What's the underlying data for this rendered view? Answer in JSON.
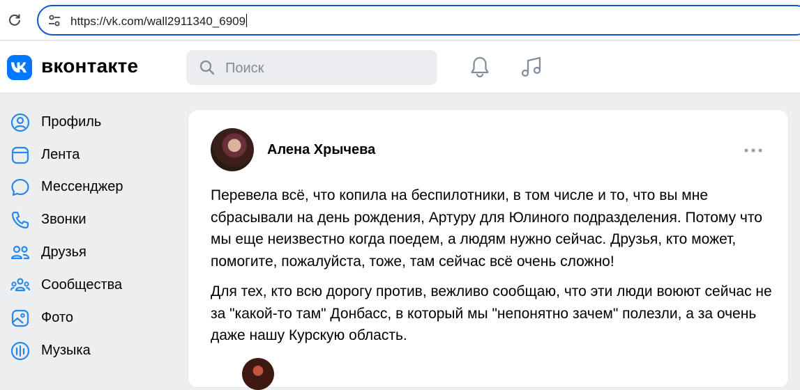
{
  "browser": {
    "url": "https://vk.com/wall2911340_6909"
  },
  "header": {
    "logo_text": "вконтакте",
    "search_placeholder": "Поиск"
  },
  "sidebar": {
    "items": [
      {
        "label": "Профиль",
        "icon": "profile-icon"
      },
      {
        "label": "Лента",
        "icon": "feed-icon"
      },
      {
        "label": "Мессенджер",
        "icon": "messenger-icon"
      },
      {
        "label": "Звонки",
        "icon": "phone-icon"
      },
      {
        "label": "Друзья",
        "icon": "friends-icon"
      },
      {
        "label": "Сообщества",
        "icon": "communities-icon"
      },
      {
        "label": "Фото",
        "icon": "photo-icon"
      },
      {
        "label": "Музыка",
        "icon": "music-icon"
      }
    ]
  },
  "post": {
    "author": "Алена Хрычева",
    "paragraphs": [
      "Перевела всё, что копила на беспилотники, в том числе и то, что вы мне сбрасывали на день рождения, Артуру для Юлиного подразделения. Потому что мы еще неизвестно когда поедем, а людям нужно сейчас. Друзья, кто может, помогите, пожалуйста, тоже, там сейчас всё очень сложно!",
      "Для тех, кто всю дорогу против, вежливо сообщаю, что эти люди воюют сейчас не за \"какой-то там\" Донбасс, в который мы \"непонятно зачем\" полезли, а за очень даже нашу Курскую область."
    ]
  },
  "colors": {
    "accent": "#0077ff",
    "icon": "#2688eb",
    "page_bg": "#edeef0"
  }
}
